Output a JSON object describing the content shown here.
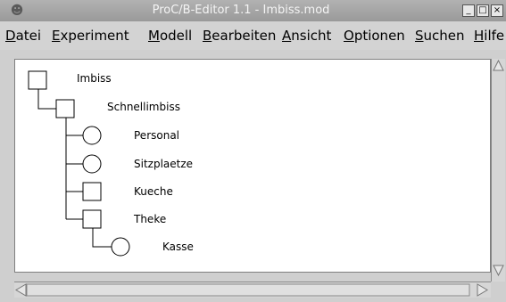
{
  "window": {
    "title": "ProC/B-Editor 1.1 - Imbiss.mod"
  },
  "menu": [
    {
      "label": "Datei"
    },
    {
      "label": "Experiment"
    },
    {
      "label": "Modell"
    },
    {
      "label": "Bearbeiten"
    },
    {
      "label": "Ansicht"
    },
    {
      "label": "Optionen"
    },
    {
      "label": "Suchen"
    },
    {
      "label": "Hilfe"
    }
  ],
  "tree": {
    "nodes": [
      {
        "label": "Imbiss",
        "shape": "square"
      },
      {
        "label": "Schnellimbiss",
        "shape": "square"
      },
      {
        "label": "Personal",
        "shape": "circle"
      },
      {
        "label": "Sitzplaetze",
        "shape": "circle"
      },
      {
        "label": "Kueche",
        "shape": "square"
      },
      {
        "label": "Theke",
        "shape": "square"
      },
      {
        "label": "Kasse",
        "shape": "circle"
      }
    ]
  }
}
